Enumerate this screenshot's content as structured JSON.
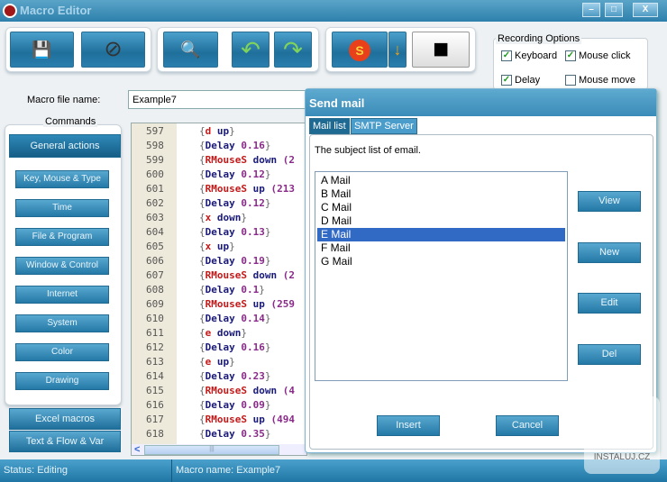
{
  "window": {
    "title": "Macro Editor",
    "minimize": "–",
    "maximize": "□",
    "close": "X"
  },
  "toolbar": {
    "buttons": [
      {
        "icon": "save-icon",
        "glyph": "💾"
      },
      {
        "icon": "cancel-icon",
        "glyph": "⊘"
      },
      {
        "icon": "search-icon",
        "glyph": "🔍"
      },
      {
        "icon": "undo-icon",
        "glyph": "↶"
      },
      {
        "icon": "redo-icon",
        "glyph": "↷"
      },
      {
        "icon": "record-icon",
        "glyph": "S"
      },
      {
        "icon": "dropdown-arrow-icon",
        "glyph": "↓"
      },
      {
        "icon": "stop-icon",
        "glyph": "■"
      }
    ]
  },
  "recording_options": {
    "title": "Recording Options",
    "keyboard": {
      "label": "Keyboard",
      "checked": true
    },
    "mouse_click": {
      "label": "Mouse click",
      "checked": true
    },
    "delay": {
      "label": "Delay",
      "checked": true
    },
    "mouse_move": {
      "label": "Mouse move",
      "checked": false
    },
    "check": "✓"
  },
  "macro_file": {
    "label": "Macro file name:",
    "value": "Example7"
  },
  "commands": {
    "title": "Commands",
    "general": "General actions",
    "items": [
      "Key, Mouse & Type",
      "Time",
      "File & Program",
      "Window & Control",
      "Internet",
      "System",
      "Color",
      "Drawing"
    ],
    "excel": "Excel macros",
    "flow": "Text & Flow & Var"
  },
  "editor": {
    "lines": [
      {
        "n": "597",
        "t": [
          [
            "{",
            "b"
          ],
          [
            "d ",
            "r"
          ],
          [
            "up",
            "k"
          ],
          [
            "}",
            "b"
          ]
        ]
      },
      {
        "n": "598",
        "t": [
          [
            "{",
            "b"
          ],
          [
            "Delay ",
            "k"
          ],
          [
            "0.16",
            "n"
          ],
          [
            "}",
            "b"
          ]
        ]
      },
      {
        "n": "599",
        "t": [
          [
            "{",
            "b"
          ],
          [
            "RMouseS ",
            "r"
          ],
          [
            "down ",
            "k"
          ],
          [
            "(2",
            "n"
          ]
        ]
      },
      {
        "n": "600",
        "t": [
          [
            "{",
            "b"
          ],
          [
            "Delay ",
            "k"
          ],
          [
            "0.12",
            "n"
          ],
          [
            "}",
            "b"
          ]
        ]
      },
      {
        "n": "601",
        "t": [
          [
            "{",
            "b"
          ],
          [
            "RMouseS ",
            "r"
          ],
          [
            "up ",
            "k"
          ],
          [
            "(213",
            "n"
          ]
        ]
      },
      {
        "n": "602",
        "t": [
          [
            "{",
            "b"
          ],
          [
            "Delay ",
            "k"
          ],
          [
            "0.12",
            "n"
          ],
          [
            "}",
            "b"
          ]
        ]
      },
      {
        "n": "603",
        "t": [
          [
            "{",
            "b"
          ],
          [
            "x ",
            "r"
          ],
          [
            "down",
            "k"
          ],
          [
            "}",
            "b"
          ]
        ]
      },
      {
        "n": "604",
        "t": [
          [
            "{",
            "b"
          ],
          [
            "Delay ",
            "k"
          ],
          [
            "0.13",
            "n"
          ],
          [
            "}",
            "b"
          ]
        ]
      },
      {
        "n": "605",
        "t": [
          [
            "{",
            "b"
          ],
          [
            "x ",
            "r"
          ],
          [
            "up",
            "k"
          ],
          [
            "}",
            "b"
          ]
        ]
      },
      {
        "n": "606",
        "t": [
          [
            "{",
            "b"
          ],
          [
            "Delay ",
            "k"
          ],
          [
            "0.19",
            "n"
          ],
          [
            "}",
            "b"
          ]
        ]
      },
      {
        "n": "607",
        "t": [
          [
            "{",
            "b"
          ],
          [
            "RMouseS ",
            "r"
          ],
          [
            "down ",
            "k"
          ],
          [
            "(2",
            "n"
          ]
        ]
      },
      {
        "n": "608",
        "t": [
          [
            "{",
            "b"
          ],
          [
            "Delay ",
            "k"
          ],
          [
            "0.1",
            "n"
          ],
          [
            "}",
            "b"
          ]
        ]
      },
      {
        "n": "609",
        "t": [
          [
            "{",
            "b"
          ],
          [
            "RMouseS ",
            "r"
          ],
          [
            "up ",
            "k"
          ],
          [
            "(259",
            "n"
          ]
        ]
      },
      {
        "n": "610",
        "t": [
          [
            "{",
            "b"
          ],
          [
            "Delay ",
            "k"
          ],
          [
            "0.14",
            "n"
          ],
          [
            "}",
            "b"
          ]
        ]
      },
      {
        "n": "611",
        "t": [
          [
            "{",
            "b"
          ],
          [
            "e ",
            "r"
          ],
          [
            "down",
            "k"
          ],
          [
            "}",
            "b"
          ]
        ]
      },
      {
        "n": "612",
        "t": [
          [
            "{",
            "b"
          ],
          [
            "Delay ",
            "k"
          ],
          [
            "0.16",
            "n"
          ],
          [
            "}",
            "b"
          ]
        ]
      },
      {
        "n": "613",
        "t": [
          [
            "{",
            "b"
          ],
          [
            "e ",
            "r"
          ],
          [
            "up",
            "k"
          ],
          [
            "}",
            "b"
          ]
        ]
      },
      {
        "n": "614",
        "t": [
          [
            "{",
            "b"
          ],
          [
            "Delay ",
            "k"
          ],
          [
            "0.23",
            "n"
          ],
          [
            "}",
            "b"
          ]
        ]
      },
      {
        "n": "615",
        "t": [
          [
            "{",
            "b"
          ],
          [
            "RMouseS ",
            "r"
          ],
          [
            "down ",
            "k"
          ],
          [
            "(4",
            "n"
          ]
        ]
      },
      {
        "n": "616",
        "t": [
          [
            "{",
            "b"
          ],
          [
            "Delay ",
            "k"
          ],
          [
            "0.09",
            "n"
          ],
          [
            "}",
            "b"
          ]
        ]
      },
      {
        "n": "617",
        "t": [
          [
            "{",
            "b"
          ],
          [
            "RMouseS ",
            "r"
          ],
          [
            "up ",
            "k"
          ],
          [
            "(494",
            "n"
          ]
        ]
      },
      {
        "n": "618",
        "t": [
          [
            "{",
            "b"
          ],
          [
            "Delay ",
            "k"
          ],
          [
            "0.35",
            "n"
          ],
          [
            "}",
            "b"
          ]
        ]
      }
    ],
    "scroll_left": "<",
    "scroll_grip": "|||"
  },
  "dialog": {
    "title": "Send mail",
    "tabs": [
      "Mail list",
      "SMTP Server"
    ],
    "active_tab": 0,
    "description": "The subject list of email.",
    "mails": [
      "A Mail",
      "B Mail",
      "C Mail",
      "D Mail",
      "E Mail",
      "F Mail",
      "G Mail"
    ],
    "selected": 4,
    "buttons": {
      "view": "View",
      "new": "New",
      "edit": "Edit",
      "del": "Del",
      "insert": "Insert",
      "cancel": "Cancel"
    }
  },
  "status": {
    "status": "Status: Editing",
    "macro": "Macro name: Example7"
  },
  "watermark": "INSTALUJ.CZ"
}
